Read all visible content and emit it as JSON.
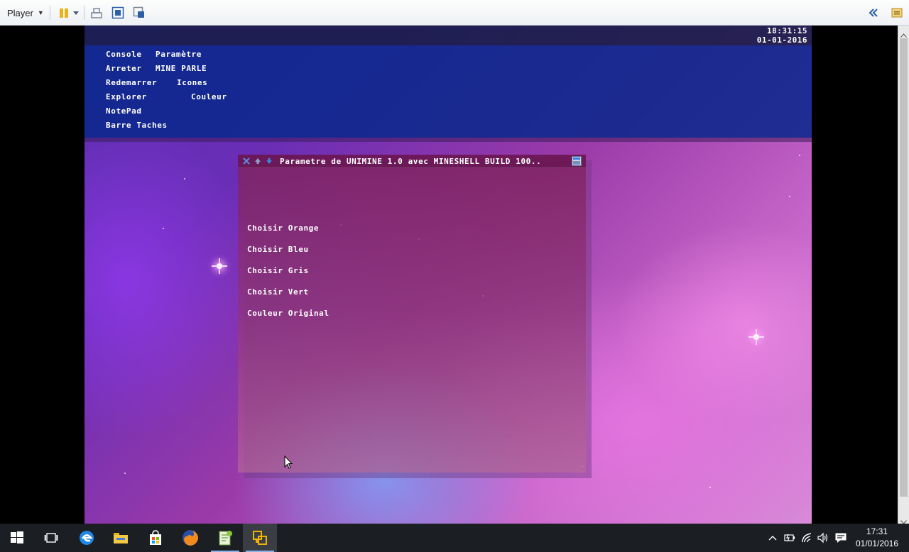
{
  "player_bar": {
    "menu_label": "Player",
    "icons": [
      "pause-icon",
      "dropdown-caret-icon",
      "send-ctrl-alt-del-icon",
      "fullscreen-icon",
      "unity-icon",
      "back-arrows-icon",
      "library-icon"
    ]
  },
  "vm": {
    "clock_time": "18:31:15",
    "clock_date": "01-01-2016",
    "menu_items": [
      {
        "label": "Console"
      },
      {
        "label": "Paramètre"
      },
      {
        "label": "Arreter"
      },
      {
        "label": "MINE PARLE"
      },
      {
        "label": "Redemarrer"
      },
      {
        "label": "Icones"
      },
      {
        "label": "Explorer"
      },
      {
        "label": "Couleur"
      },
      {
        "label": "NotePad"
      },
      {
        "label": "Barre Taches"
      }
    ],
    "settings_window": {
      "title": "Parametre de UNIMINE 1.0 avec MINESHELL BUILD 100..",
      "options": [
        "Choisir Orange",
        "Choisir Bleu",
        "Choisir Gris",
        "Choisir Vert",
        "Couleur Original"
      ]
    }
  },
  "taskbar": {
    "apps": [
      "start-icon",
      "task-view-icon",
      "edge-icon",
      "file-explorer-icon",
      "store-icon",
      "firefox-icon",
      "notepad-plus-plus-icon",
      "vmware-player-icon"
    ],
    "tray_icons": [
      "show-hidden-chevron-icon",
      "power-icon",
      "network-icon",
      "volume-icon",
      "action-center-icon"
    ],
    "time": "17:31",
    "date": "01/01/2016"
  },
  "colors": {
    "menu_panel": "#0a288c",
    "window": "#8a2a70",
    "accent_blue": "#3f7ee0"
  }
}
